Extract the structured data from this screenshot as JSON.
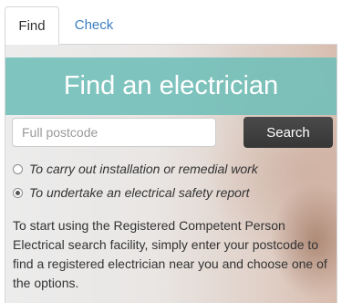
{
  "tabs": {
    "find_label": "Find",
    "check_label": "Check"
  },
  "banner": {
    "title": "Find an electrician"
  },
  "search": {
    "placeholder": "Full postcode",
    "value": "",
    "button_label": "Search"
  },
  "options": [
    {
      "label": "To carry out installation or remedial work",
      "selected": false
    },
    {
      "label": "To undertake an electrical safety report",
      "selected": true
    }
  ],
  "intro_text": "To start using the Registered Competent Person Electrical search facility, simply enter your postcode to find a registered electrician near you and choose one of the options.",
  "colors": {
    "banner": "#6fbeb8",
    "button": "#3f3f3f",
    "tab_link": "#3a7fc1"
  }
}
